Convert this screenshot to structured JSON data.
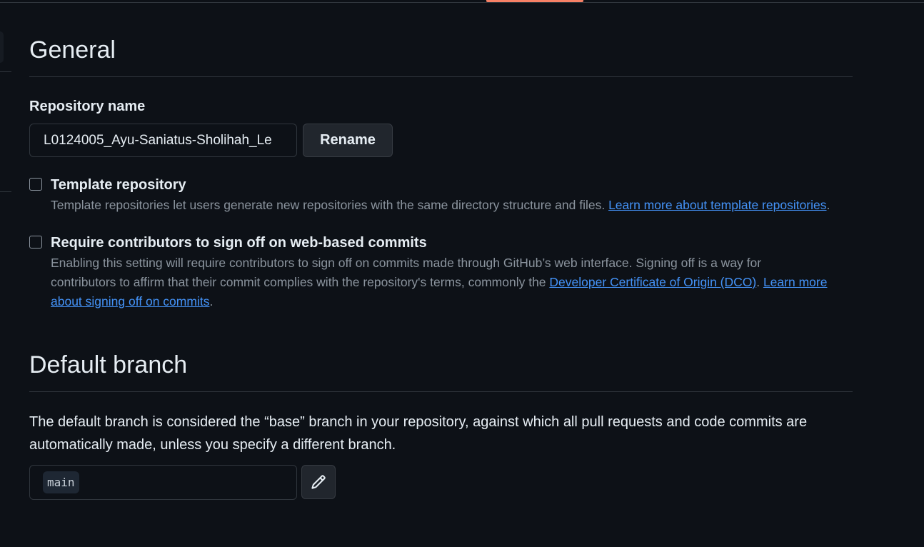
{
  "general": {
    "title": "General",
    "repo_label": "Repository name",
    "repo_value": "L0124005_Ayu-Saniatus-Sholihah_Le",
    "rename_label": "Rename"
  },
  "template_repo": {
    "title": "Template repository",
    "desc": "Template repositories let users generate new repositories with the same directory structure and files. ",
    "link": "Learn more about template repositories",
    "end": "."
  },
  "signoff": {
    "title": "Require contributors to sign off on web-based commits",
    "desc": "Enabling this setting will require contributors to sign off on commits made through GitHub’s web interface. Signing off is a way for contributors to affirm that their commit complies with the repository's terms, commonly the ",
    "link1": "Developer Certificate of Origin (DCO)",
    "mid": ". ",
    "link2": "Learn more about signing off on commits",
    "end": "."
  },
  "default_branch": {
    "title": "Default branch",
    "desc": "The default branch is considered the “base” branch in your repository, against which all pull requests and code commits are automatically made, unless you specify a different branch.",
    "branch": "main"
  },
  "icons": {
    "edit": "pencil-icon"
  },
  "colors": {
    "background": "#0d1117",
    "link": "#4493f8",
    "active_tab": "#f78166",
    "muted_text": "#8b949e"
  }
}
